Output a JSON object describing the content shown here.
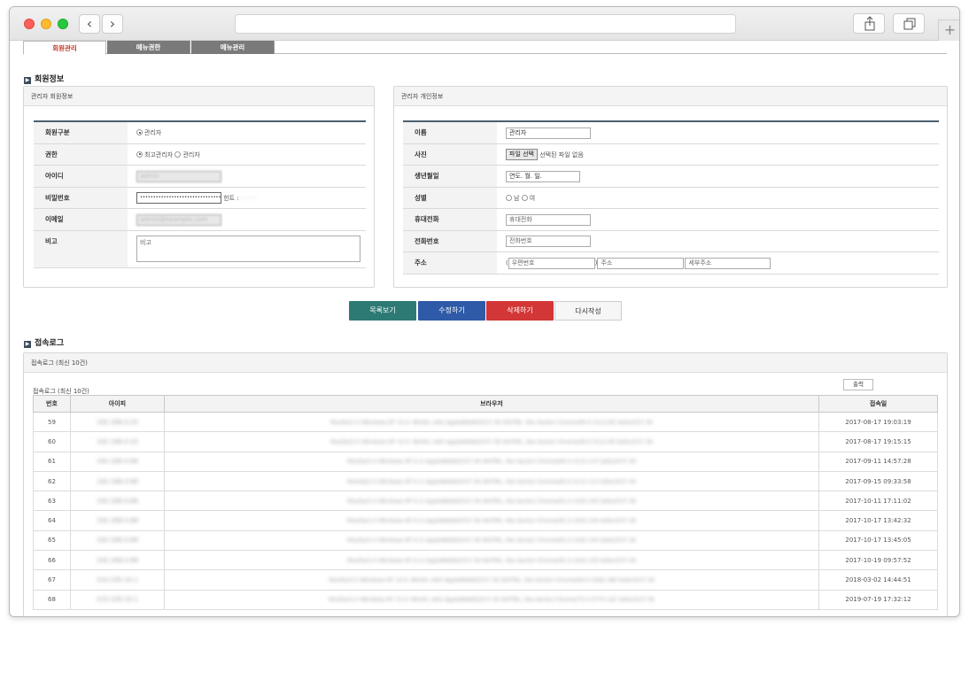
{
  "tabs": [
    {
      "label": "회원관리",
      "active": true
    },
    {
      "label": "메뉴권한",
      "active": false
    },
    {
      "label": "메뉴관리",
      "active": false
    }
  ],
  "member_section": {
    "title": "회원정보"
  },
  "admin_panel": {
    "title": "관리자 회원정보",
    "rows": {
      "member_type": {
        "label": "회원구분",
        "option": "관리자"
      },
      "permission": {
        "label": "권한",
        "option1": "최고관리자",
        "option2": "관리자"
      },
      "id": {
        "label": "아이디",
        "value": "admin"
      },
      "password": {
        "label": "비밀번호",
        "value": "••••••••••••••••••••••••••••••••••••••••",
        "hint_label": "힌트 :"
      },
      "email": {
        "label": "이메일",
        "value": "admin@example.com"
      },
      "note": {
        "label": "비고",
        "placeholder": "비고"
      }
    }
  },
  "personal_panel": {
    "title": "관리자 개인정보",
    "rows": {
      "name": {
        "label": "이름",
        "value": "관리자"
      },
      "photo": {
        "label": "사진",
        "button": "파일 선택",
        "status": "선택된 파일 없음"
      },
      "birth": {
        "label": "생년월일",
        "value": "연도. 월. 일."
      },
      "gender": {
        "label": "성별",
        "option1": "남",
        "option2": "여"
      },
      "mobile": {
        "label": "휴대전화",
        "placeholder": "휴대전화"
      },
      "phone": {
        "label": "전화번호",
        "placeholder": "전화번호"
      },
      "address": {
        "label": "주소",
        "zip_placeholder": "우편번호",
        "addr_placeholder": "주소",
        "detail_placeholder": "세부주소",
        "paren_open": "(",
        "paren_close": ")"
      }
    }
  },
  "buttons": {
    "list": "목록보기",
    "edit": "수정하기",
    "delete": "삭제하기",
    "reset": "다시작성"
  },
  "log_section": {
    "title": "접속로그",
    "panel_title": "접속로그 (최신 10건)",
    "table_caption": "접속로그 (최신 10건)",
    "excel_button": "출력",
    "columns": [
      "번호",
      "아이피",
      "브라우저",
      "접속일"
    ],
    "rows": [
      {
        "no": "59",
        "ip": "192.168.0.20",
        "browser": "Mozilla/5.0 (Windows NT 10.0; Win64; x64) AppleWebKit/537.36 (KHTML, like Gecko) Chrome/60.0.3112.90 Safari/537.36",
        "date": "2017-08-17 19:03:19"
      },
      {
        "no": "60",
        "ip": "192.168.0.20",
        "browser": "Mozilla/5.0 (Windows NT 10.0; Win64; x64) AppleWebKit/537.36 (KHTML, like Gecko) Chrome/60.0.3112.90 Safari/537.36",
        "date": "2017-08-17 19:15:15"
      },
      {
        "no": "61",
        "ip": "192.168.0.88",
        "browser": "Mozilla/5.0 (Windows NT 6.1) AppleWebKit/537.36 (KHTML, like Gecko) Chrome/60.0.3112.113 Safari/537.36",
        "date": "2017-09-11 14:57:28"
      },
      {
        "no": "62",
        "ip": "192.168.0.88",
        "browser": "Mozilla/5.0 (Windows NT 6.1) AppleWebKit/537.36 (KHTML, like Gecko) Chrome/60.0.3112.113 Safari/537.36",
        "date": "2017-09-15 09:33:58"
      },
      {
        "no": "63",
        "ip": "192.168.0.88",
        "browser": "Mozilla/5.0 (Windows NT 6.1) AppleWebKit/537.36 (KHTML, like Gecko) Chrome/61.0.3163.100 Safari/537.36",
        "date": "2017-10-11 17:11:02"
      },
      {
        "no": "64",
        "ip": "192.168.0.88",
        "browser": "Mozilla/5.0 (Windows NT 6.1) AppleWebKit/537.36 (KHTML, like Gecko) Chrome/61.0.3163.100 Safari/537.36",
        "date": "2017-10-17 13:42:32"
      },
      {
        "no": "65",
        "ip": "192.168.0.88",
        "browser": "Mozilla/5.0 (Windows NT 6.1) AppleWebKit/537.36 (KHTML, like Gecko) Chrome/61.0.3163.100 Safari/537.36",
        "date": "2017-10-17 13:45:05"
      },
      {
        "no": "66",
        "ip": "192.168.0.88",
        "browser": "Mozilla/5.0 (Windows NT 6.1) AppleWebKit/537.36 (KHTML, like Gecko) Chrome/61.0.3163.100 Safari/537.36",
        "date": "2017-10-19 09:57:52"
      },
      {
        "no": "67",
        "ip": "210.100.10.1",
        "browser": "Mozilla/5.0 (Windows NT 10.0; Win64; x64) AppleWebKit/537.36 (KHTML, like Gecko) Chrome/64.0.3282.186 Safari/537.36",
        "date": "2018-03-02 14:44:51"
      },
      {
        "no": "68",
        "ip": "210.100.10.1",
        "browser": "Mozilla/5.0 (Windows NT 10.0; Win64; x64) AppleWebKit/537.36 (KHTML, like Gecko) Chrome/75.0.3770.142 Safari/537.36",
        "date": "2019-07-19 17:32:12"
      }
    ]
  }
}
